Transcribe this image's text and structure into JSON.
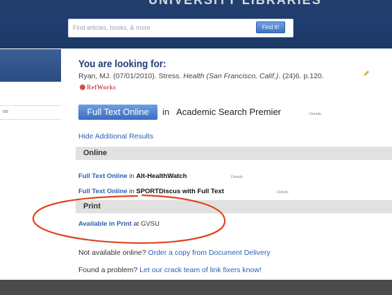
{
  "header": {
    "title": "UNIVERSITY LIBRARIES",
    "search_placeholder": "Find articles, books, & more",
    "search_button": "Find It!"
  },
  "sidebar": {
    "text": "oo"
  },
  "result": {
    "heading": "You are looking for:",
    "citation_prefix": "Ryan, MJ. (07/01/2010). Stress. ",
    "citation_journal": "Health (San Francisco, Calif.)",
    "citation_suffix": ". (24)6. p.120.",
    "refworks_label": "RefWorks",
    "fulltext_button": "Full Text Online",
    "fulltext_in": "in",
    "fulltext_database": "Academic Search Premier",
    "fulltext_details": "Details",
    "hide_additional": "Hide Additional Results"
  },
  "online_section": {
    "label": "Online",
    "items": [
      {
        "link": "Full Text Online",
        "in": " in ",
        "database": "Alt-HealthWatch",
        "details": "Details"
      },
      {
        "link": "Full Text Online",
        "in": " in ",
        "database": "SPORTDiscus with Full Text",
        "details": "Details"
      }
    ]
  },
  "print_section": {
    "label": "Print",
    "link": "Available in Print",
    "suffix": " at GVSU"
  },
  "footer_links": {
    "doc_prefix": "Not available online? ",
    "doc_link": "Order a copy from Document Delivery",
    "problem_prefix": "Found a problem? ",
    "problem_link": "Let our crack team of link fixers know!"
  },
  "colors": {
    "header_blue": "#1e3c6e",
    "link_blue": "#2b5eb1",
    "annotation_red": "#e0421a",
    "section_gray": "#e1e1e1"
  }
}
